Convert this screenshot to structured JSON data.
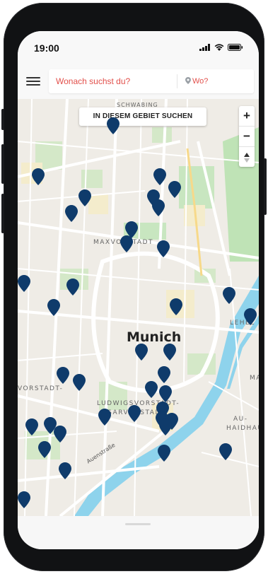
{
  "status_bar": {
    "time": "19:00",
    "icons": [
      "signal-icon",
      "wifi-icon",
      "battery-icon"
    ]
  },
  "search": {
    "menu_icon": "hamburger-menu-icon",
    "what_placeholder": "Wonach suchst du?",
    "where_icon": "location-pin-icon",
    "where_placeholder": "Wo?",
    "accent_color": "#e2504b"
  },
  "map": {
    "search_area_label": "IN DIESEM GEBIET SUCHEN",
    "zoom_in_label": "+",
    "zoom_out_label": "−",
    "compass_icon": "compass-icon",
    "city_label": "Munich",
    "district_labels": {
      "schwabing": "SCHWABING",
      "maxvorstadt": "MAXVORSTADT",
      "lehel": "LEHEL",
      "vorstadt": "VORSTADT-",
      "ludwigsvorstadt_1": "LUDWIGSVORSTADT-",
      "ludwigsvorstadt_2": "ISARVORSTADT",
      "au_1": "AU-",
      "au_2": "HAIDHAU",
      "maxv_short": "MAX",
      "street": "Auenstraße"
    },
    "pin_color": "#0f3b6b",
    "pin_icon": "map-marker-icon"
  },
  "bottom_sheet": {
    "handle_icon": "drag-handle-icon"
  }
}
